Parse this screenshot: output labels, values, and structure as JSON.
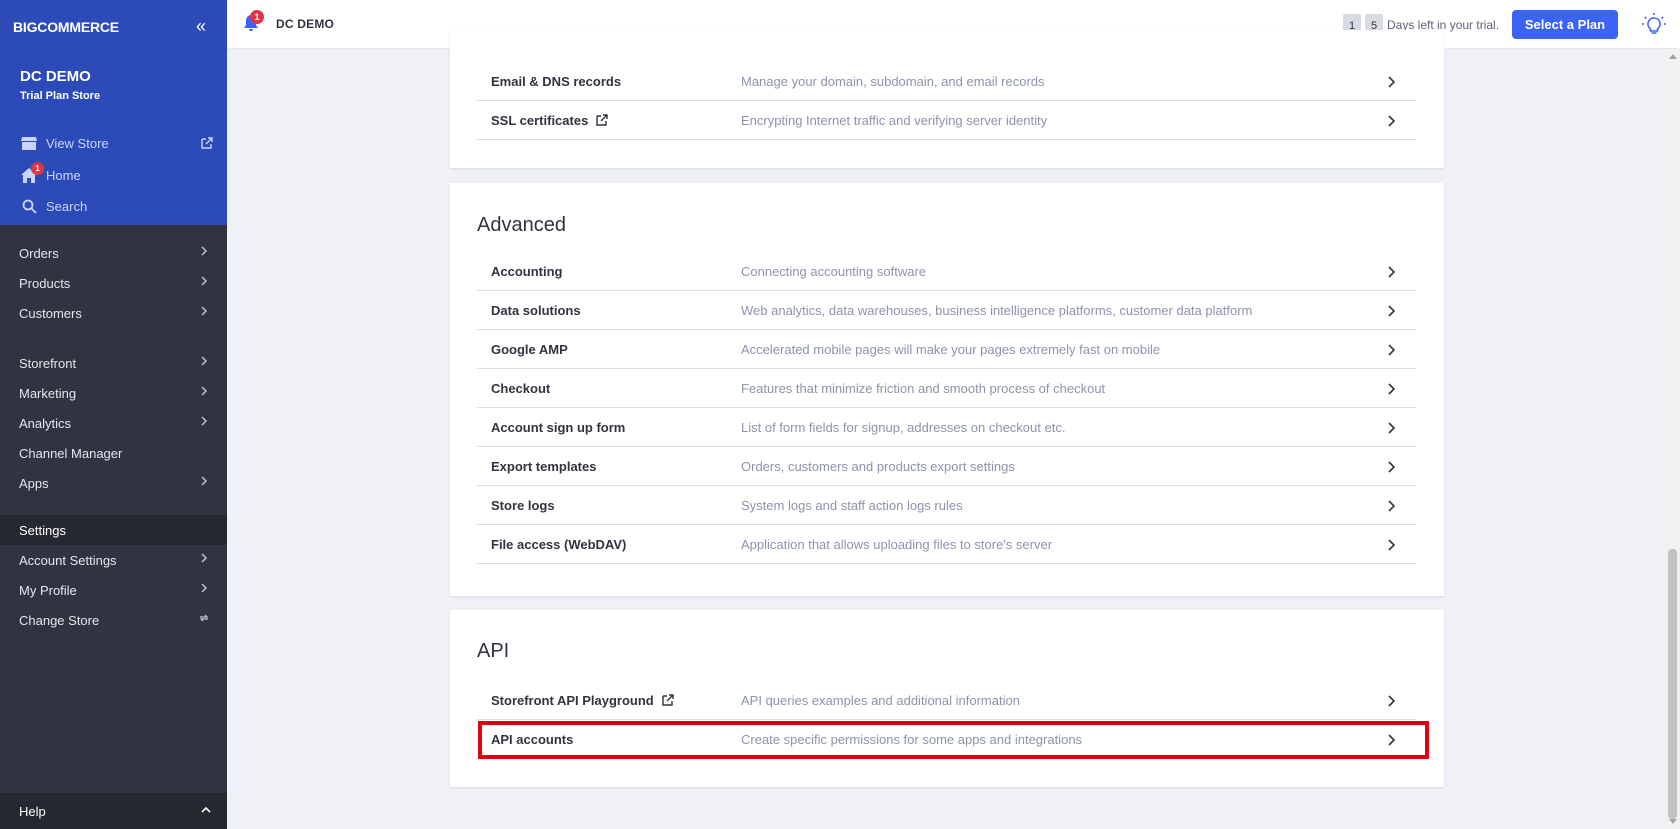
{
  "sidebar": {
    "logo": "BIGCOMMERCE",
    "store_name": "DC DEMO",
    "plan": "Trial Plan Store",
    "view_store": "View Store",
    "home": "Home",
    "home_badge": "1",
    "search": "Search",
    "nav": [
      {
        "label": "Orders"
      },
      {
        "label": "Products"
      },
      {
        "label": "Customers"
      },
      {
        "label": "Storefront"
      },
      {
        "label": "Marketing"
      },
      {
        "label": "Analytics"
      },
      {
        "label": "Channel Manager"
      },
      {
        "label": "Apps"
      },
      {
        "label": "Settings"
      },
      {
        "label": "Account Settings"
      },
      {
        "label": "My Profile"
      },
      {
        "label": "Change Store"
      }
    ],
    "help": "Help"
  },
  "header": {
    "notification_count": "1",
    "store_name": "DC DEMO",
    "trial_days": [
      "1",
      "5"
    ],
    "trial_text": "Days left in your trial.",
    "select_plan": "Select a Plan"
  },
  "colors": {
    "accent": "#3c64f4",
    "sidebar": "#313440",
    "highlight": "#e00010"
  },
  "sections": {
    "top": {
      "rows": [
        {
          "title": "Email & DNS records",
          "desc": "Manage your domain, subdomain, and email records"
        },
        {
          "title": "SSL certificates",
          "desc": "Encrypting Internet traffic and verifying server identity"
        }
      ]
    },
    "advanced": {
      "title": "Advanced",
      "rows": [
        {
          "title": "Accounting",
          "desc": "Connecting accounting software"
        },
        {
          "title": "Data solutions",
          "desc": "Web analytics, data warehouses, business intelligence platforms, customer data platform"
        },
        {
          "title": "Google AMP",
          "desc": "Accelerated mobile pages will make your pages extremely fast on mobile"
        },
        {
          "title": "Checkout",
          "desc": "Features that minimize friction and smooth process of checkout"
        },
        {
          "title": "Account sign up form",
          "desc": "List of form fields for signup, addresses on checkout etc."
        },
        {
          "title": "Export templates",
          "desc": "Orders, customers and products export settings"
        },
        {
          "title": "Store logs",
          "desc": "System logs and staff action logs rules"
        },
        {
          "title": "File access (WebDAV)",
          "desc": "Application that allows uploading files to store's server"
        }
      ]
    },
    "api": {
      "title": "API",
      "rows": [
        {
          "title": "Storefront API Playground",
          "desc": "API queries examples and additional information"
        },
        {
          "title": "API accounts",
          "desc": "Create specific permissions for some apps and integrations"
        }
      ]
    }
  }
}
